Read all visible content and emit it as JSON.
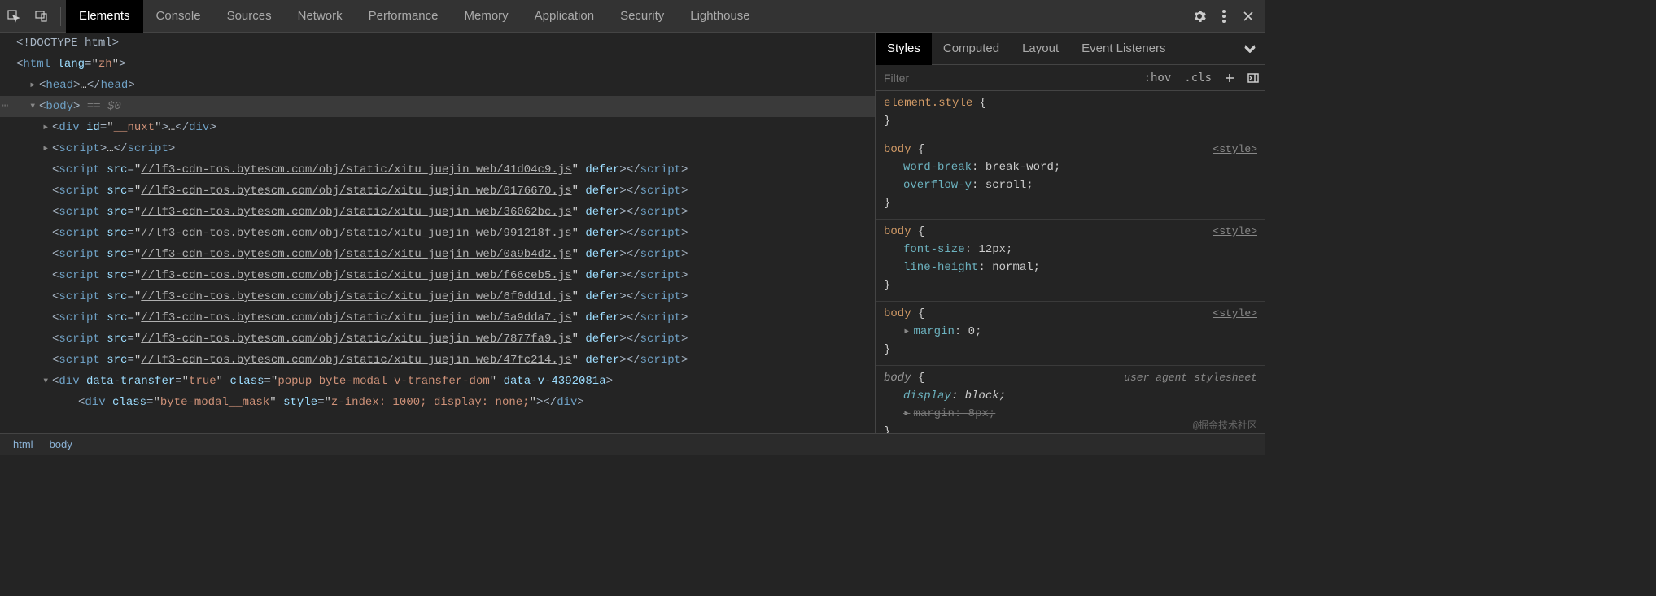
{
  "topbar": {
    "tabs": [
      "Elements",
      "Console",
      "Sources",
      "Network",
      "Performance",
      "Memory",
      "Application",
      "Security",
      "Lighthouse"
    ],
    "active_index": 0
  },
  "dom": {
    "doctype": "<!DOCTYPE html>",
    "html_open": {
      "tag": "html",
      "attrs": [
        {
          "n": "lang",
          "v": "zh"
        }
      ]
    },
    "head_line": {
      "collapsed": true,
      "tag": "head"
    },
    "body_line": {
      "tag": "body",
      "selected_marker": "== $0"
    },
    "children": [
      {
        "type": "elem_collapsed",
        "tag": "div",
        "attrs": [
          {
            "n": "id",
            "v": "__nuxt"
          }
        ],
        "ellipsis": true,
        "close": true,
        "caret": true
      },
      {
        "type": "elem_collapsed",
        "tag": "script",
        "attrs": [],
        "ellipsis": true,
        "close": true,
        "caret": true
      },
      {
        "type": "script_src",
        "src": "//lf3-cdn-tos.bytescm.com/obj/static/xitu_juejin_web/41d04c9.js",
        "defer": true
      },
      {
        "type": "script_src",
        "src": "//lf3-cdn-tos.bytescm.com/obj/static/xitu_juejin_web/0176670.js",
        "defer": true
      },
      {
        "type": "script_src",
        "src": "//lf3-cdn-tos.bytescm.com/obj/static/xitu_juejin_web/36062bc.js",
        "defer": true
      },
      {
        "type": "script_src",
        "src": "//lf3-cdn-tos.bytescm.com/obj/static/xitu_juejin_web/991218f.js",
        "defer": true
      },
      {
        "type": "script_src",
        "src": "//lf3-cdn-tos.bytescm.com/obj/static/xitu_juejin_web/0a9b4d2.js",
        "defer": true
      },
      {
        "type": "script_src",
        "src": "//lf3-cdn-tos.bytescm.com/obj/static/xitu_juejin_web/f66ceb5.js",
        "defer": true
      },
      {
        "type": "script_src",
        "src": "//lf3-cdn-tos.bytescm.com/obj/static/xitu_juejin_web/6f0dd1d.js",
        "defer": true
      },
      {
        "type": "script_src",
        "src": "//lf3-cdn-tos.bytescm.com/obj/static/xitu_juejin_web/5a9dda7.js",
        "defer": true
      },
      {
        "type": "script_src",
        "src": "//lf3-cdn-tos.bytescm.com/obj/static/xitu_juejin_web/7877fa9.js",
        "defer": true
      },
      {
        "type": "script_src",
        "src": "//lf3-cdn-tos.bytescm.com/obj/static/xitu_juejin_web/47fc214.js",
        "defer": true
      },
      {
        "type": "elem_open",
        "tag": "div",
        "caret": "down",
        "attrs": [
          {
            "n": "data-transfer",
            "v": "true"
          },
          {
            "n": "class",
            "v": "popup byte-modal v-transfer-dom"
          },
          {
            "n": "data-v-4392081a",
            "bare": true
          }
        ]
      },
      {
        "type": "elem_full",
        "tag": "div",
        "attrs": [
          {
            "n": "class",
            "v": "byte-modal__mask"
          },
          {
            "n": "style",
            "v": "z-index: 1000; display: none;"
          }
        ],
        "close": true,
        "indent": 2
      }
    ]
  },
  "styles_panel": {
    "tabs": [
      "Styles",
      "Computed",
      "Layout",
      "Event Listeners"
    ],
    "active_index": 0,
    "filter_placeholder": "Filter",
    "hov_label": ":hov",
    "cls_label": ".cls",
    "rules": [
      {
        "selector": "element.style",
        "link": null,
        "declarations": []
      },
      {
        "selector": "body",
        "link": "<style>",
        "declarations": [
          {
            "prop": "word-break",
            "value": "break-word;"
          },
          {
            "prop": "overflow-y",
            "value": "scroll;"
          }
        ]
      },
      {
        "selector": "body",
        "link": "<style>",
        "declarations": [
          {
            "prop": "font-size",
            "value": "12px;"
          },
          {
            "prop": "line-height",
            "value": "normal;"
          }
        ]
      },
      {
        "selector": "body",
        "link": "<style>",
        "declarations": [
          {
            "prop": "margin",
            "value": "0;",
            "marker": "▸"
          }
        ]
      },
      {
        "selector": "body",
        "ua": "user agent stylesheet",
        "italic": true,
        "declarations": [
          {
            "prop": "display",
            "value": "block;",
            "italic": true
          },
          {
            "prop": "margin",
            "value": "8px;",
            "marker": "▸",
            "strike": true
          }
        ]
      }
    ],
    "watermark": "@掘金技术社区"
  },
  "breadcrumb": [
    "html",
    "body"
  ]
}
